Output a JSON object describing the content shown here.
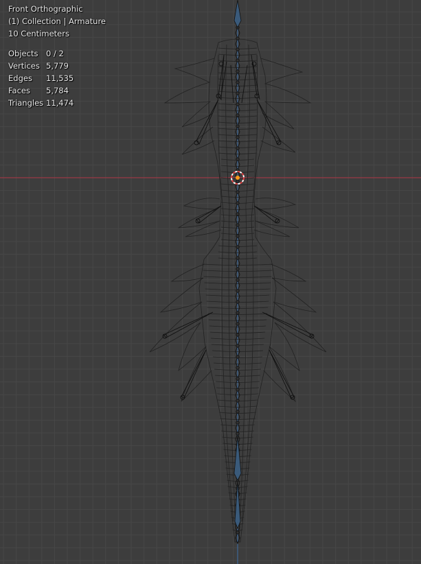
{
  "viewport": {
    "view_name": "Front Orthographic",
    "collection_info": "(1) Collection | Armature",
    "grid_scale": "10 Centimeters"
  },
  "stats": [
    {
      "label": "Objects",
      "value": "0 / 2"
    },
    {
      "label": "Vertices",
      "value": "5,779"
    },
    {
      "label": "Edges",
      "value": "11,535"
    },
    {
      "label": "Faces",
      "value": "5,784"
    },
    {
      "label": "Triangles",
      "value": "11,474"
    }
  ],
  "colors": {
    "background": "#3d3d3d",
    "grid": "#474747",
    "x_axis": "#9a3a45",
    "z_axis": "#3d6ea8",
    "wire": "#222222",
    "cursor_red": "#e04040",
    "origin": "#ff9a1a"
  }
}
